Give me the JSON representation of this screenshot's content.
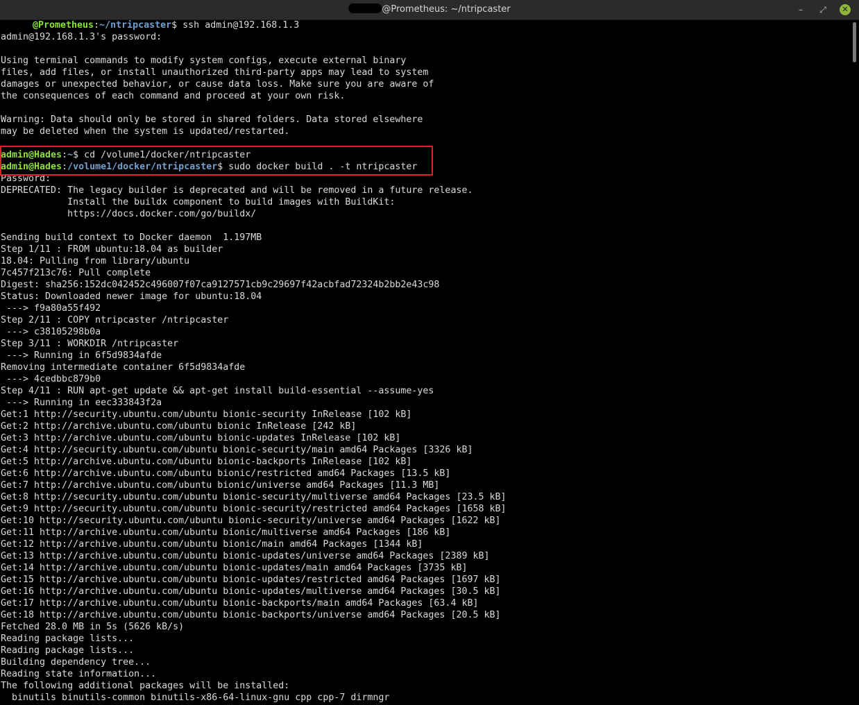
{
  "window": {
    "title_suffix": "@Prometheus: ~/ntripcaster",
    "minimize": "–",
    "restore": "⤢",
    "close": "✕"
  },
  "terminal": {
    "first_prompt": {
      "host": "@Prometheus",
      "sep": ":",
      "path": "~/ntripcaster",
      "cmd": "$ ssh admin@192.168.1.3"
    },
    "lines_a": [
      "admin@192.168.1.3's password:",
      "",
      "Using terminal commands to modify system configs, execute external binary",
      "files, add files, or install unauthorized third-party apps may lead to system",
      "damages or unexpected behavior, or cause data loss. Make sure you are aware of",
      "the consequences of each command and proceed at your own risk.",
      "",
      "Warning: Data should only be stored in shared folders. Data stored elsewhere",
      "may be deleted when the system is updated/restarted.",
      ""
    ],
    "prompt2": {
      "user": "admin@Hades",
      "sep": ":",
      "path": "~",
      "cmd": "$ cd /volume1/docker/ntripcaster"
    },
    "prompt3": {
      "user": "admin@Hades",
      "sep": ":",
      "path": "/volume1/docker/ntripcaster",
      "cmd": "$ sudo docker build . -t ntripcaster"
    },
    "lines_b": [
      "Password:",
      "DEPRECATED: The legacy builder is deprecated and will be removed in a future release.",
      "            Install the buildx component to build images with BuildKit:",
      "            https://docs.docker.com/go/buildx/",
      "",
      "Sending build context to Docker daemon  1.197MB",
      "Step 1/11 : FROM ubuntu:18.04 as builder",
      "18.04: Pulling from library/ubuntu",
      "7c457f213c76: Pull complete",
      "Digest: sha256:152dc042452c496007f07ca9127571cb9c29697f42acbfad72324b2bb2e43c98",
      "Status: Downloaded newer image for ubuntu:18.04",
      " ---> f9a80a55f492",
      "Step 2/11 : COPY ntripcaster /ntripcaster",
      " ---> c38105298b0a",
      "Step 3/11 : WORKDIR /ntripcaster",
      " ---> Running in 6f5d9834afde",
      "Removing intermediate container 6f5d9834afde",
      " ---> 4cedbbc879b0",
      "Step 4/11 : RUN apt-get update && apt-get install build-essential --assume-yes",
      " ---> Running in eec333843f2a",
      "Get:1 http://security.ubuntu.com/ubuntu bionic-security InRelease [102 kB]",
      "Get:2 http://archive.ubuntu.com/ubuntu bionic InRelease [242 kB]",
      "Get:3 http://archive.ubuntu.com/ubuntu bionic-updates InRelease [102 kB]",
      "Get:4 http://security.ubuntu.com/ubuntu bionic-security/main amd64 Packages [3326 kB]",
      "Get:5 http://archive.ubuntu.com/ubuntu bionic-backports InRelease [102 kB]",
      "Get:6 http://archive.ubuntu.com/ubuntu bionic/restricted amd64 Packages [13.5 kB]",
      "Get:7 http://archive.ubuntu.com/ubuntu bionic/universe amd64 Packages [11.3 MB]",
      "Get:8 http://security.ubuntu.com/ubuntu bionic-security/multiverse amd64 Packages [23.5 kB]",
      "Get:9 http://security.ubuntu.com/ubuntu bionic-security/restricted amd64 Packages [1658 kB]",
      "Get:10 http://security.ubuntu.com/ubuntu bionic-security/universe amd64 Packages [1622 kB]",
      "Get:11 http://archive.ubuntu.com/ubuntu bionic/multiverse amd64 Packages [186 kB]",
      "Get:12 http://archive.ubuntu.com/ubuntu bionic/main amd64 Packages [1344 kB]",
      "Get:13 http://archive.ubuntu.com/ubuntu bionic-updates/universe amd64 Packages [2389 kB]",
      "Get:14 http://archive.ubuntu.com/ubuntu bionic-updates/main amd64 Packages [3735 kB]",
      "Get:15 http://archive.ubuntu.com/ubuntu bionic-updates/restricted amd64 Packages [1697 kB]",
      "Get:16 http://archive.ubuntu.com/ubuntu bionic-updates/multiverse amd64 Packages [30.5 kB]",
      "Get:17 http://archive.ubuntu.com/ubuntu bionic-backports/main amd64 Packages [63.4 kB]",
      "Get:18 http://archive.ubuntu.com/ubuntu bionic-backports/universe amd64 Packages [20.5 kB]",
      "Fetched 28.0 MB in 5s (5626 kB/s)",
      "Reading package lists...",
      "Reading package lists...",
      "Building dependency tree...",
      "Reading state information...",
      "The following additional packages will be installed:",
      "  binutils binutils-common binutils-x86-64-linux-gnu cpp cpp-7 dirmngr"
    ]
  },
  "colors": {
    "prompt_user": "#8ae234",
    "prompt_path": "#729fcf",
    "highlight_box": "#e0202a",
    "close_button": "#8fb53a"
  }
}
